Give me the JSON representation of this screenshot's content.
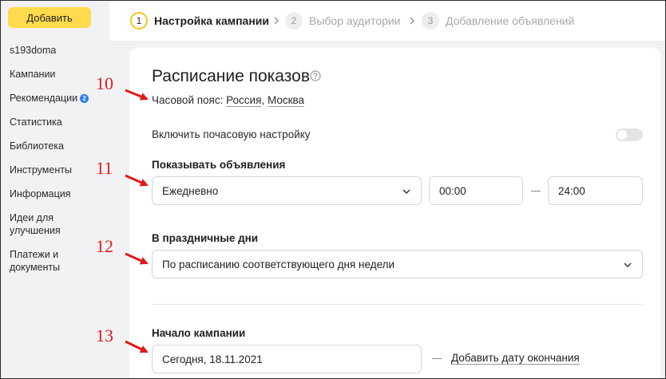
{
  "sidebar": {
    "add_button": "Добавить",
    "account": "s193doma",
    "items": [
      {
        "label": "Кампании"
      },
      {
        "label": "Рекомендации",
        "badge": "2"
      },
      {
        "label": "Статистика"
      },
      {
        "label": "Библиотека"
      },
      {
        "label": "Инструменты"
      },
      {
        "label": "Информация"
      },
      {
        "label": "Идеи для улучшения"
      },
      {
        "label": "Платежи и документы"
      }
    ]
  },
  "stepper": {
    "steps": [
      {
        "num": "1",
        "label": "Настройка кампании",
        "active": true
      },
      {
        "num": "2",
        "label": "Выбор аудитории",
        "active": false
      },
      {
        "num": "3",
        "label": "Добавление объявлений",
        "active": false
      }
    ]
  },
  "schedule": {
    "title": "Расписание показов",
    "timezone_prefix": "Часовой пояс:",
    "timezone_country": "Россия",
    "timezone_sep": ",",
    "timezone_city": "Москва",
    "hourly_label": "Включить почасовую настройку",
    "hourly_enabled": false,
    "show_label": "Показывать объявления",
    "show_value": "Ежедневно",
    "time_from": "00:00",
    "time_to": "24:00",
    "holidays_label": "В праздничные дни",
    "holidays_value": "По расписанию соответствующего дня недели",
    "start_label": "Начало кампании",
    "start_value": "Сегодня, 18.11.2021",
    "end_link": "Добавить дату окончания"
  },
  "annotations": [
    "10",
    "11",
    "12",
    "13"
  ],
  "colors": {
    "accent_yellow": "#ffdb4d",
    "badge_blue": "#2a7ef0",
    "annotation_red": "#e01a1a"
  }
}
